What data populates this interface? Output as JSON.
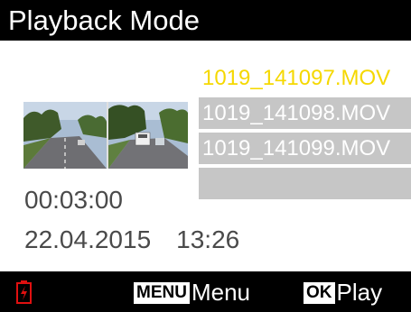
{
  "header": {
    "title": "Playback Mode"
  },
  "files": [
    {
      "name": "1019_141097.MOV",
      "selected": true
    },
    {
      "name": "1019_141098.MOV",
      "selected": false
    },
    {
      "name": "1019_141099.MOV",
      "selected": false
    },
    {
      "name": "",
      "selected": false
    }
  ],
  "info": {
    "duration": "00:03:00",
    "date": "22.04.2015",
    "time": "13:26"
  },
  "footer": {
    "menu_key": "MENU",
    "menu_label": "Menu",
    "ok_key": "OK",
    "ok_label": "Play",
    "battery_icon": "battery-low-icon"
  },
  "colors": {
    "header_bg": "#000000",
    "selected_text": "#f5d800",
    "list_item_bg": "#c6c6c6",
    "battery_red": "#e01010"
  }
}
